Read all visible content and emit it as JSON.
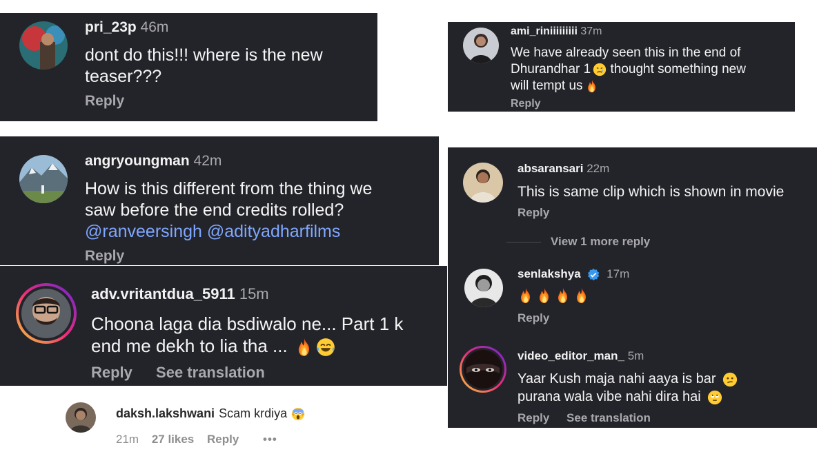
{
  "colors": {
    "card_bg": "#23242a",
    "text": "#f5f5f5",
    "muted": "#a8a8ad",
    "mention": "#7fa7ff",
    "story_ring_start": "#f9ce34",
    "story_ring_mid": "#ee2a7b",
    "story_ring_end": "#6228d7",
    "verified": "#3897f0"
  },
  "comments": [
    {
      "user": "pri_23p",
      "time": "46m",
      "lines": [
        "dont do this!!! where is the new",
        "teaser???"
      ],
      "reply": "Reply"
    },
    {
      "user": "ami_riniiiiiiiii",
      "time": "37m",
      "lines": [
        "We have already seen this in the end of",
        "Dhurandhar 1",
        "will tempt us"
      ],
      "line2_tail": "thought something new",
      "emoji": [
        "crying-face-icon",
        "fire-icon"
      ],
      "reply": "Reply"
    },
    {
      "user": "angryoungman",
      "time": "42m",
      "lines": [
        "How is this different from the thing we",
        "saw before the end credits rolled?"
      ],
      "mentions": [
        "@ranveersingh",
        "@adityadharfilms"
      ],
      "reply": "Reply"
    },
    {
      "user": "absaransari",
      "time": "22m",
      "lines": [
        "This is same clip which is shown in movie"
      ],
      "reply": "Reply",
      "view_more": "View 1 more reply"
    },
    {
      "user": "adv.vritantdua_5911",
      "time": "15m",
      "lines": [
        "Choona laga dia bsdiwalo ne... Part 1 k",
        "end me dekh to lia tha ..."
      ],
      "emoji": [
        "fire-icon",
        "joy-face-icon"
      ],
      "reply": "Reply",
      "see_translation": "See translation"
    },
    {
      "user": "senlakshya",
      "time": "17m",
      "verified": true,
      "emoji": [
        "fire-icon",
        "fire-icon",
        "fire-icon",
        "fire-icon"
      ],
      "reply": "Reply"
    },
    {
      "user": "video_editor_man_",
      "time": "5m",
      "lines": [
        "Yaar Kush maja nahi aaya is bar",
        "purana wala vibe nahi dira hai"
      ],
      "emoji": [
        "confused-face-icon",
        "eye-roll-face-icon"
      ],
      "reply": "Reply",
      "see_translation": "See translation"
    },
    {
      "user": "daksh.lakshwani",
      "text": "Scam krdiya",
      "time": "21m",
      "likes": "27 likes",
      "reply": "Reply",
      "more": "•••",
      "emoji": [
        "scream-face-icon"
      ]
    }
  ]
}
